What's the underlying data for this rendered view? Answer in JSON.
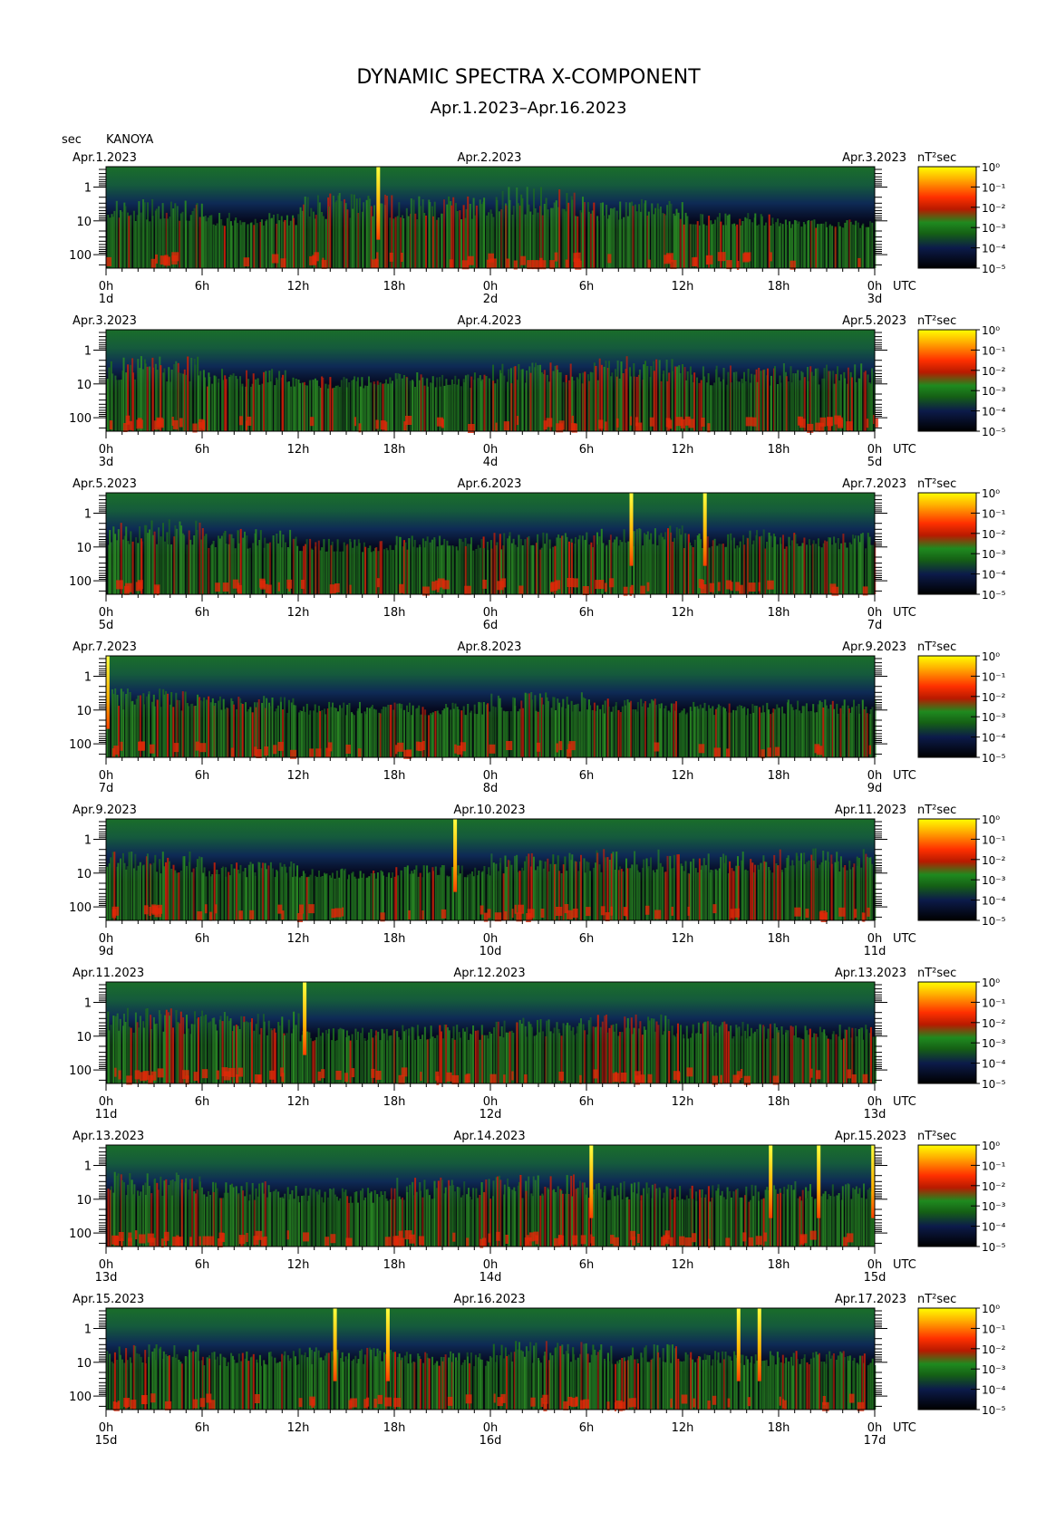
{
  "title": "DYNAMIC SPECTRA X-COMPONENT",
  "subtitle": "Apr.1.2023–Apr.16.2023",
  "y_unit": "sec",
  "station": "KANOYA",
  "utc_label": "UTC",
  "colorbar": {
    "unit_label": "nT²sec",
    "ticks": [
      "10⁰",
      "10⁻¹",
      "10⁻²",
      "10⁻³",
      "10⁻⁴",
      "10⁻⁵"
    ],
    "colors": [
      "#ffff00",
      "#ffb000",
      "#ff3000",
      "#cc1a00",
      "#1f8a1f",
      "#156015",
      "#0c1b4a",
      "#000000"
    ]
  },
  "chart_data": {
    "type": "heatmap",
    "y_axis": {
      "label": "sec",
      "scale": "log",
      "ticks": [
        "1",
        "10",
        "100"
      ],
      "range": [
        0.25,
        250
      ]
    },
    "x_ticks": [
      "0h",
      "6h",
      "12h",
      "18h",
      "0h",
      "6h",
      "12h",
      "18h",
      "0h"
    ],
    "colorbar_range": [
      "10⁻⁵",
      "10⁰"
    ],
    "panels": [
      {
        "date_left": "Apr.1.2023",
        "date_mid": "Apr.2.2023",
        "date_right": "Apr.3.2023",
        "days": [
          "1d",
          "2d",
          "3d"
        ],
        "spikes_hours": [
          17.0
        ],
        "activity": [
          0.5,
          0.3,
          0.6,
          0.55,
          0.7,
          0.5,
          0.3,
          0.2
        ]
      },
      {
        "date_left": "Apr.3.2023",
        "date_mid": "Apr.4.2023",
        "date_right": "Apr.5.2023",
        "days": [
          "3d",
          "4d",
          "5d"
        ],
        "spikes_hours": [],
        "activity": [
          0.6,
          0.4,
          0.3,
          0.35,
          0.5,
          0.6,
          0.45,
          0.5
        ]
      },
      {
        "date_left": "Apr.5.2023",
        "date_mid": "Apr.6.2023",
        "date_right": "Apr.7.2023",
        "days": [
          "5d",
          "6d",
          "7d"
        ],
        "spikes_hours": [
          32.8,
          37.4
        ],
        "activity": [
          0.6,
          0.45,
          0.3,
          0.35,
          0.4,
          0.5,
          0.45,
          0.4
        ]
      },
      {
        "date_left": "Apr.7.2023",
        "date_mid": "Apr.8.2023",
        "date_right": "Apr.9.2023",
        "days": [
          "7d",
          "8d",
          "9d"
        ],
        "spikes_hours": [
          0.1
        ],
        "activity": [
          0.5,
          0.4,
          0.3,
          0.3,
          0.45,
          0.35,
          0.3,
          0.35
        ]
      },
      {
        "date_left": "Apr.9.2023",
        "date_mid": "Apr.10.2023",
        "date_right": "Apr.11.2023",
        "days": [
          "9d",
          "10d",
          "11d"
        ],
        "spikes_hours": [
          21.8
        ],
        "activity": [
          0.5,
          0.35,
          0.25,
          0.3,
          0.5,
          0.55,
          0.5,
          0.55
        ]
      },
      {
        "date_left": "Apr.11.2023",
        "date_mid": "Apr.12.2023",
        "date_right": "Apr.13.2023",
        "days": [
          "11d",
          "12d",
          "13d"
        ],
        "spikes_hours": [
          12.4
        ],
        "activity": [
          0.6,
          0.55,
          0.3,
          0.35,
          0.45,
          0.5,
          0.4,
          0.35
        ]
      },
      {
        "date_left": "Apr.13.2023",
        "date_mid": "Apr.14.2023",
        "date_right": "Apr.15.2023",
        "days": [
          "13d",
          "14d",
          "15d"
        ],
        "spikes_hours": [
          30.3,
          41.5,
          44.5,
          47.9
        ],
        "activity": [
          0.6,
          0.45,
          0.35,
          0.5,
          0.55,
          0.45,
          0.4,
          0.45
        ]
      },
      {
        "date_left": "Apr.15.2023",
        "date_mid": "Apr.16.2023",
        "date_right": "Apr.17.2023",
        "days": [
          "15d",
          "16d",
          "17d"
        ],
        "spikes_hours": [
          14.3,
          17.6,
          39.5,
          40.8
        ],
        "activity": [
          0.45,
          0.35,
          0.4,
          0.35,
          0.5,
          0.45,
          0.35,
          0.35
        ]
      }
    ]
  }
}
